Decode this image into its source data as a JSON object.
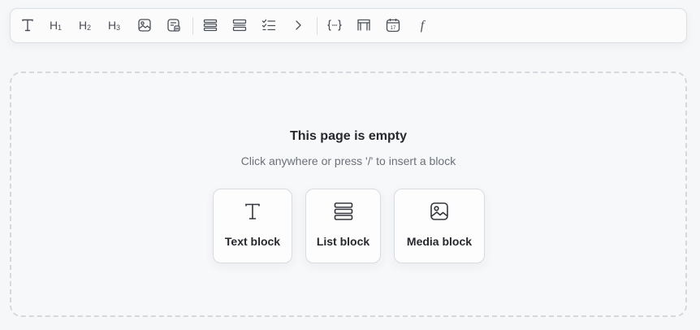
{
  "toolbar": {
    "groups": [
      [
        {
          "icon": "text-icon"
        },
        {
          "icon": "heading-1-icon",
          "label": "H",
          "sub": "1"
        },
        {
          "icon": "heading-2-icon",
          "label": "H",
          "sub": "2"
        },
        {
          "icon": "heading-3-icon",
          "label": "H",
          "sub": "3"
        },
        {
          "icon": "image-icon"
        },
        {
          "icon": "embed-icon"
        }
      ],
      [
        {
          "icon": "list-icon"
        },
        {
          "icon": "stack-list-icon"
        },
        {
          "icon": "checklist-icon"
        },
        {
          "icon": "chevron-right-icon"
        }
      ],
      [
        {
          "icon": "code-braces-icon"
        },
        {
          "icon": "table-icon"
        },
        {
          "icon": "calendar-icon",
          "label": "17"
        },
        {
          "icon": "function-icon",
          "label": "f"
        }
      ]
    ]
  },
  "canvas": {
    "title": "This page is empty",
    "subtitle": "Click anywhere or press '/' to insert a block"
  },
  "blocks": [
    {
      "label": "Text block",
      "icon": "text-icon"
    },
    {
      "label": "List block",
      "icon": "list-icon"
    },
    {
      "label": "Media block",
      "icon": "image-icon"
    }
  ]
}
